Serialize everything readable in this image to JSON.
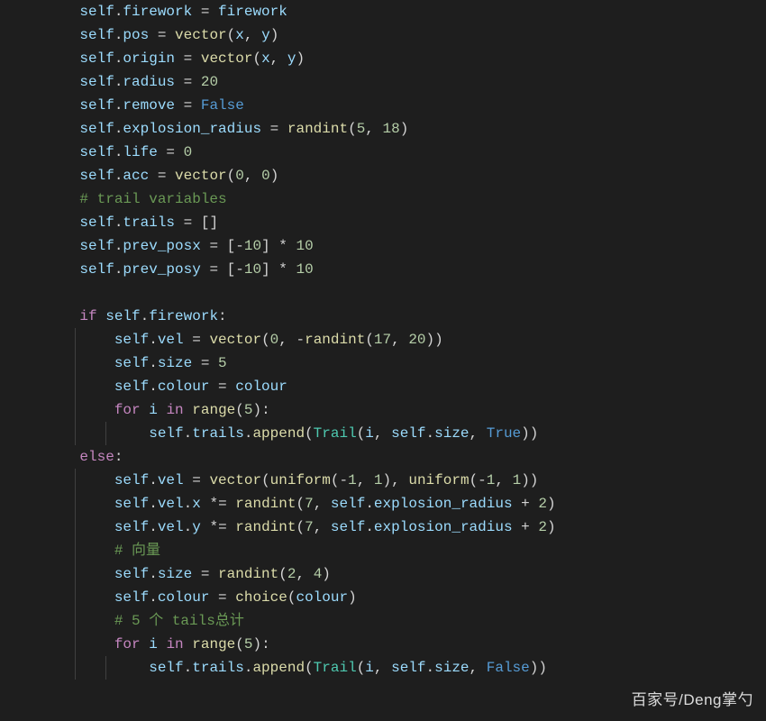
{
  "watermark": "百家号/Deng掌勺",
  "code": {
    "lines": [
      {
        "indent": 1,
        "tokens": [
          [
            "var",
            "self"
          ],
          [
            "punc",
            "."
          ],
          [
            "var",
            "firework"
          ],
          [
            "op",
            " = "
          ],
          [
            "var",
            "firework"
          ]
        ]
      },
      {
        "indent": 1,
        "tokens": [
          [
            "var",
            "self"
          ],
          [
            "punc",
            "."
          ],
          [
            "var",
            "pos"
          ],
          [
            "op",
            " = "
          ],
          [
            "func",
            "vector"
          ],
          [
            "punc",
            "("
          ],
          [
            "var",
            "x"
          ],
          [
            "punc",
            ", "
          ],
          [
            "var",
            "y"
          ],
          [
            "punc",
            ")"
          ]
        ]
      },
      {
        "indent": 1,
        "tokens": [
          [
            "var",
            "self"
          ],
          [
            "punc",
            "."
          ],
          [
            "var",
            "origin"
          ],
          [
            "op",
            " = "
          ],
          [
            "func",
            "vector"
          ],
          [
            "punc",
            "("
          ],
          [
            "var",
            "x"
          ],
          [
            "punc",
            ", "
          ],
          [
            "var",
            "y"
          ],
          [
            "punc",
            ")"
          ]
        ]
      },
      {
        "indent": 1,
        "tokens": [
          [
            "var",
            "self"
          ],
          [
            "punc",
            "."
          ],
          [
            "var",
            "radius"
          ],
          [
            "op",
            " = "
          ],
          [
            "num",
            "20"
          ]
        ]
      },
      {
        "indent": 1,
        "tokens": [
          [
            "var",
            "self"
          ],
          [
            "punc",
            "."
          ],
          [
            "var",
            "remove"
          ],
          [
            "op",
            " = "
          ],
          [
            "const",
            "False"
          ]
        ]
      },
      {
        "indent": 1,
        "tokens": [
          [
            "var",
            "self"
          ],
          [
            "punc",
            "."
          ],
          [
            "var",
            "explosion_radius"
          ],
          [
            "op",
            " = "
          ],
          [
            "func",
            "randint"
          ],
          [
            "punc",
            "("
          ],
          [
            "num",
            "5"
          ],
          [
            "punc",
            ", "
          ],
          [
            "num",
            "18"
          ],
          [
            "punc",
            ")"
          ]
        ]
      },
      {
        "indent": 1,
        "tokens": [
          [
            "var",
            "self"
          ],
          [
            "punc",
            "."
          ],
          [
            "var",
            "life"
          ],
          [
            "op",
            " = "
          ],
          [
            "num",
            "0"
          ]
        ]
      },
      {
        "indent": 1,
        "tokens": [
          [
            "var",
            "self"
          ],
          [
            "punc",
            "."
          ],
          [
            "var",
            "acc"
          ],
          [
            "op",
            " = "
          ],
          [
            "func",
            "vector"
          ],
          [
            "punc",
            "("
          ],
          [
            "num",
            "0"
          ],
          [
            "punc",
            ", "
          ],
          [
            "num",
            "0"
          ],
          [
            "punc",
            ")"
          ]
        ]
      },
      {
        "indent": 1,
        "tokens": [
          [
            "comment",
            "# trail variables"
          ]
        ]
      },
      {
        "indent": 1,
        "tokens": [
          [
            "var",
            "self"
          ],
          [
            "punc",
            "."
          ],
          [
            "var",
            "trails"
          ],
          [
            "op",
            " = "
          ],
          [
            "punc",
            "[]"
          ]
        ]
      },
      {
        "indent": 1,
        "tokens": [
          [
            "var",
            "self"
          ],
          [
            "punc",
            "."
          ],
          [
            "var",
            "prev_posx"
          ],
          [
            "op",
            " = "
          ],
          [
            "punc",
            "["
          ],
          [
            "op",
            "-"
          ],
          [
            "num",
            "10"
          ],
          [
            "punc",
            "] "
          ],
          [
            "op",
            "* "
          ],
          [
            "num",
            "10"
          ]
        ]
      },
      {
        "indent": 1,
        "tokens": [
          [
            "var",
            "self"
          ],
          [
            "punc",
            "."
          ],
          [
            "var",
            "prev_posy"
          ],
          [
            "op",
            " = "
          ],
          [
            "punc",
            "["
          ],
          [
            "op",
            "-"
          ],
          [
            "num",
            "10"
          ],
          [
            "punc",
            "] "
          ],
          [
            "op",
            "* "
          ],
          [
            "num",
            "10"
          ]
        ]
      },
      {
        "indent": 1,
        "tokens": []
      },
      {
        "indent": 1,
        "tokens": [
          [
            "kw",
            "if"
          ],
          [
            "op",
            " "
          ],
          [
            "var",
            "self"
          ],
          [
            "punc",
            "."
          ],
          [
            "var",
            "firework"
          ],
          [
            "punc",
            ":"
          ]
        ]
      },
      {
        "indent": 2,
        "guide": 1,
        "tokens": [
          [
            "var",
            "self"
          ],
          [
            "punc",
            "."
          ],
          [
            "var",
            "vel"
          ],
          [
            "op",
            " = "
          ],
          [
            "func",
            "vector"
          ],
          [
            "punc",
            "("
          ],
          [
            "num",
            "0"
          ],
          [
            "punc",
            ", "
          ],
          [
            "op",
            "-"
          ],
          [
            "func",
            "randint"
          ],
          [
            "punc",
            "("
          ],
          [
            "num",
            "17"
          ],
          [
            "punc",
            ", "
          ],
          [
            "num",
            "20"
          ],
          [
            "punc",
            "))"
          ]
        ]
      },
      {
        "indent": 2,
        "guide": 1,
        "tokens": [
          [
            "var",
            "self"
          ],
          [
            "punc",
            "."
          ],
          [
            "var",
            "size"
          ],
          [
            "op",
            " = "
          ],
          [
            "num",
            "5"
          ]
        ]
      },
      {
        "indent": 2,
        "guide": 1,
        "tokens": [
          [
            "var",
            "self"
          ],
          [
            "punc",
            "."
          ],
          [
            "var",
            "colour"
          ],
          [
            "op",
            " = "
          ],
          [
            "var",
            "colour"
          ]
        ]
      },
      {
        "indent": 2,
        "guide": 1,
        "tokens": [
          [
            "kw",
            "for"
          ],
          [
            "op",
            " "
          ],
          [
            "var",
            "i"
          ],
          [
            "op",
            " "
          ],
          [
            "kw",
            "in"
          ],
          [
            "op",
            " "
          ],
          [
            "func",
            "range"
          ],
          [
            "punc",
            "("
          ],
          [
            "num",
            "5"
          ],
          [
            "punc",
            "):"
          ]
        ]
      },
      {
        "indent": 3,
        "guide": 2,
        "tokens": [
          [
            "var",
            "self"
          ],
          [
            "punc",
            "."
          ],
          [
            "var",
            "trails"
          ],
          [
            "punc",
            "."
          ],
          [
            "func",
            "append"
          ],
          [
            "punc",
            "("
          ],
          [
            "cls",
            "Trail"
          ],
          [
            "punc",
            "("
          ],
          [
            "var",
            "i"
          ],
          [
            "punc",
            ", "
          ],
          [
            "var",
            "self"
          ],
          [
            "punc",
            "."
          ],
          [
            "var",
            "size"
          ],
          [
            "punc",
            ", "
          ],
          [
            "const",
            "True"
          ],
          [
            "punc",
            "))"
          ]
        ]
      },
      {
        "indent": 1,
        "tokens": [
          [
            "kw",
            "else"
          ],
          [
            "punc",
            ":"
          ]
        ]
      },
      {
        "indent": 2,
        "guide": 1,
        "tokens": [
          [
            "var",
            "self"
          ],
          [
            "punc",
            "."
          ],
          [
            "var",
            "vel"
          ],
          [
            "op",
            " = "
          ],
          [
            "func",
            "vector"
          ],
          [
            "punc",
            "("
          ],
          [
            "func",
            "uniform"
          ],
          [
            "punc",
            "("
          ],
          [
            "op",
            "-"
          ],
          [
            "num",
            "1"
          ],
          [
            "punc",
            ", "
          ],
          [
            "num",
            "1"
          ],
          [
            "punc",
            "), "
          ],
          [
            "func",
            "uniform"
          ],
          [
            "punc",
            "("
          ],
          [
            "op",
            "-"
          ],
          [
            "num",
            "1"
          ],
          [
            "punc",
            ", "
          ],
          [
            "num",
            "1"
          ],
          [
            "punc",
            "))"
          ]
        ]
      },
      {
        "indent": 2,
        "guide": 1,
        "tokens": [
          [
            "var",
            "self"
          ],
          [
            "punc",
            "."
          ],
          [
            "var",
            "vel"
          ],
          [
            "punc",
            "."
          ],
          [
            "var",
            "x"
          ],
          [
            "op",
            " *= "
          ],
          [
            "func",
            "randint"
          ],
          [
            "punc",
            "("
          ],
          [
            "num",
            "7"
          ],
          [
            "punc",
            ", "
          ],
          [
            "var",
            "self"
          ],
          [
            "punc",
            "."
          ],
          [
            "var",
            "explosion_radius"
          ],
          [
            "op",
            " + "
          ],
          [
            "num",
            "2"
          ],
          [
            "punc",
            ")"
          ]
        ]
      },
      {
        "indent": 2,
        "guide": 1,
        "tokens": [
          [
            "var",
            "self"
          ],
          [
            "punc",
            "."
          ],
          [
            "var",
            "vel"
          ],
          [
            "punc",
            "."
          ],
          [
            "var",
            "y"
          ],
          [
            "op",
            " *= "
          ],
          [
            "func",
            "randint"
          ],
          [
            "punc",
            "("
          ],
          [
            "num",
            "7"
          ],
          [
            "punc",
            ", "
          ],
          [
            "var",
            "self"
          ],
          [
            "punc",
            "."
          ],
          [
            "var",
            "explosion_radius"
          ],
          [
            "op",
            " + "
          ],
          [
            "num",
            "2"
          ],
          [
            "punc",
            ")"
          ]
        ]
      },
      {
        "indent": 2,
        "guide": 1,
        "tokens": [
          [
            "comment",
            "# 向量"
          ]
        ]
      },
      {
        "indent": 2,
        "guide": 1,
        "tokens": [
          [
            "var",
            "self"
          ],
          [
            "punc",
            "."
          ],
          [
            "var",
            "size"
          ],
          [
            "op",
            " = "
          ],
          [
            "func",
            "randint"
          ],
          [
            "punc",
            "("
          ],
          [
            "num",
            "2"
          ],
          [
            "punc",
            ", "
          ],
          [
            "num",
            "4"
          ],
          [
            "punc",
            ")"
          ]
        ]
      },
      {
        "indent": 2,
        "guide": 1,
        "tokens": [
          [
            "var",
            "self"
          ],
          [
            "punc",
            "."
          ],
          [
            "var",
            "colour"
          ],
          [
            "op",
            " = "
          ],
          [
            "func",
            "choice"
          ],
          [
            "punc",
            "("
          ],
          [
            "var",
            "colour"
          ],
          [
            "punc",
            ")"
          ]
        ]
      },
      {
        "indent": 2,
        "guide": 1,
        "tokens": [
          [
            "comment",
            "# 5 个 tails总计"
          ]
        ]
      },
      {
        "indent": 2,
        "guide": 1,
        "tokens": [
          [
            "kw",
            "for"
          ],
          [
            "op",
            " "
          ],
          [
            "var",
            "i"
          ],
          [
            "op",
            " "
          ],
          [
            "kw",
            "in"
          ],
          [
            "op",
            " "
          ],
          [
            "func",
            "range"
          ],
          [
            "punc",
            "("
          ],
          [
            "num",
            "5"
          ],
          [
            "punc",
            "):"
          ]
        ]
      },
      {
        "indent": 3,
        "guide": 2,
        "tokens": [
          [
            "var",
            "self"
          ],
          [
            "punc",
            "."
          ],
          [
            "var",
            "trails"
          ],
          [
            "punc",
            "."
          ],
          [
            "func",
            "append"
          ],
          [
            "punc",
            "("
          ],
          [
            "cls",
            "Trail"
          ],
          [
            "punc",
            "("
          ],
          [
            "var",
            "i"
          ],
          [
            "punc",
            ", "
          ],
          [
            "var",
            "self"
          ],
          [
            "punc",
            "."
          ],
          [
            "var",
            "size"
          ],
          [
            "punc",
            ", "
          ],
          [
            "const",
            "False"
          ],
          [
            "punc",
            "))"
          ]
        ]
      }
    ]
  }
}
